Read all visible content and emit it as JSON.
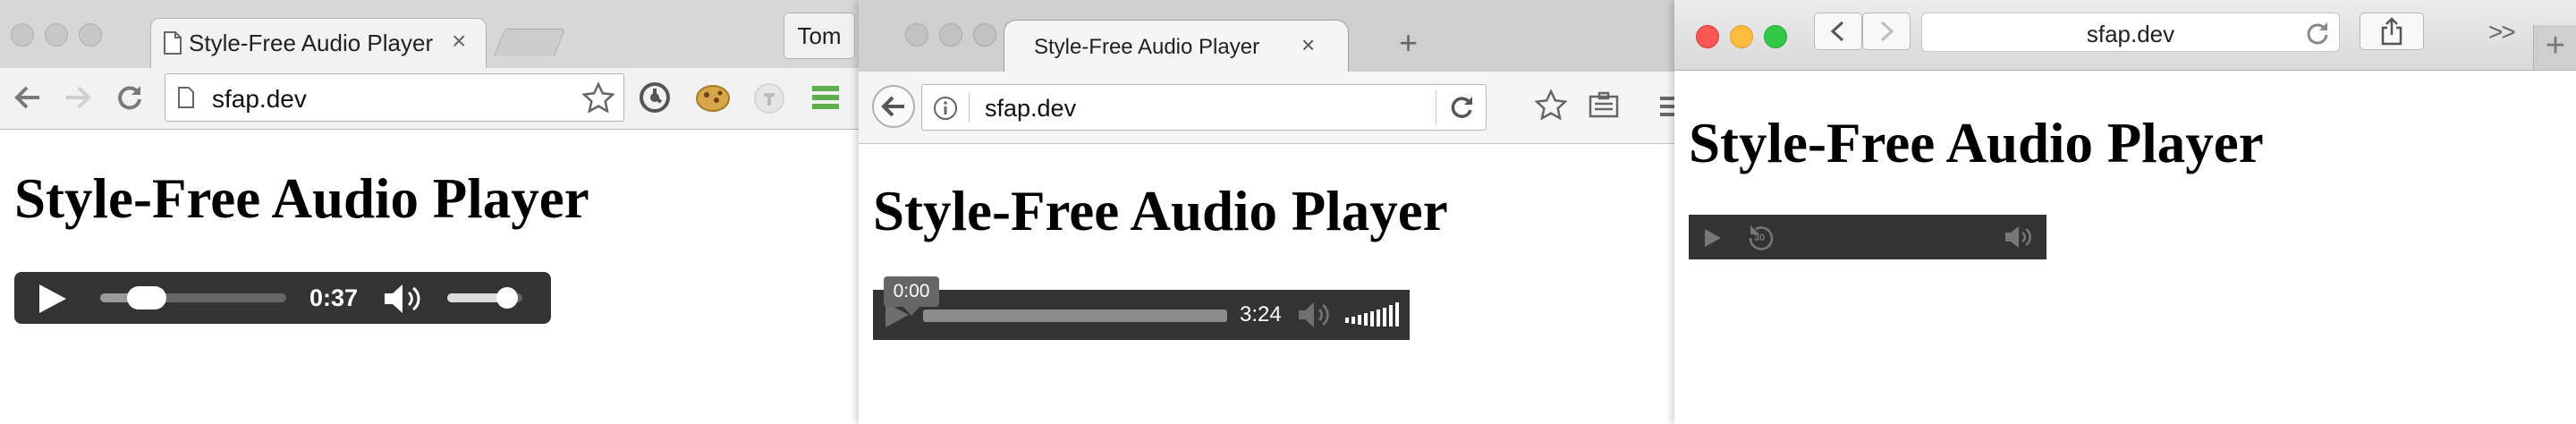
{
  "chrome": {
    "tab_title": "Style-Free Audio Player",
    "tab_close": "×",
    "profile": "Tom",
    "url": "sfap.dev",
    "heading": "Style-Free Audio Player",
    "player": {
      "time": "0:37",
      "progress": 0.25,
      "volume": 0.8
    }
  },
  "firefox": {
    "tab_title": "Style-Free Audio Player",
    "tab_close": "×",
    "new_tab": "+",
    "url": "sfap.dev",
    "heading": "Style-Free Audio Player",
    "player": {
      "tooltip": "0:00",
      "duration": "3:24",
      "progress": 0
    }
  },
  "safari": {
    "url": "sfap.dev",
    "overflow": ">>",
    "new_tab": "+",
    "heading": "Style-Free Audio Player",
    "player": {
      "skip_back_label": "30"
    }
  },
  "icons": [
    "page-icon",
    "back-icon",
    "forward-icon",
    "reload-icon",
    "star-icon",
    "extension-icon",
    "cookie-icon",
    "menu-icon",
    "info-icon",
    "reading-list-icon",
    "share-icon",
    "play-icon",
    "volume-icon",
    "skip-back-icon"
  ],
  "colors": {
    "player_bg": "#333333",
    "chrome_menu": "#5eae4e",
    "safari_close": "#fc5753",
    "safari_min": "#fdbc40",
    "safari_max": "#33c748"
  }
}
